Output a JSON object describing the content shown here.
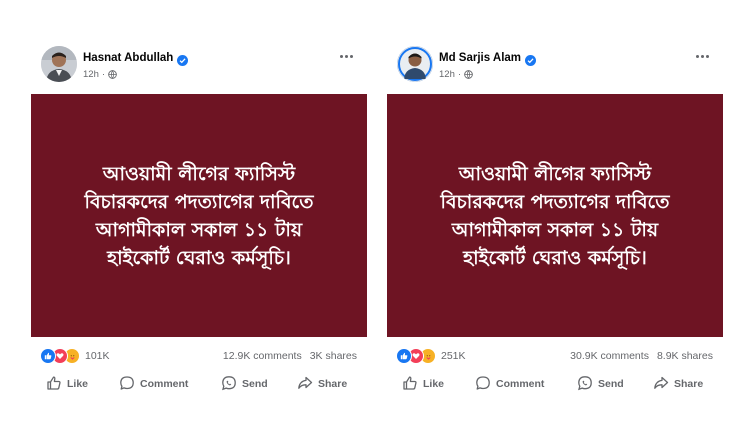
{
  "posts": [
    {
      "author": "Hasnat Abdullah",
      "verified": true,
      "time": "12h",
      "image_text": [
        "আওয়ামী লীগের ফ্যাসিস্ট",
        "বিচারকদের পদত্যাগের দাবিতে",
        "আগামীকাল সকাল ১১ টায়",
        "হাইকোর্ট ঘেরাও কর্মসূচি।"
      ],
      "reaction_count": "101K",
      "comments": "12.9K comments",
      "shares": "3K shares",
      "actions": {
        "like": "Like",
        "comment": "Comment",
        "send": "Send",
        "share": "Share"
      }
    },
    {
      "author": "Md Sarjis Alam",
      "verified": true,
      "time": "12h",
      "image_text": [
        "আওয়ামী লীগের ফ্যাসিস্ট",
        "বিচারকদের পদত্যাগের দাবিতে",
        "আগামীকাল সকাল ১১ টায়",
        "হাইকোর্ট ঘেরাও কর্মসূচি।"
      ],
      "reaction_count": "251K",
      "comments": "30.9K comments",
      "shares": "8.9K shares",
      "actions": {
        "like": "Like",
        "comment": "Comment",
        "send": "Send",
        "share": "Share"
      }
    }
  ],
  "colors": {
    "image_background": "#6e1423",
    "verified_blue": "#1877f2",
    "muted_text": "#65676b"
  },
  "icons": [
    "avatar",
    "verified-badge-icon",
    "globe-icon",
    "more-options-icon",
    "like-reaction-icon",
    "love-reaction-icon",
    "care-reaction-icon",
    "like-icon",
    "comment-icon",
    "send-icon",
    "share-icon"
  ]
}
